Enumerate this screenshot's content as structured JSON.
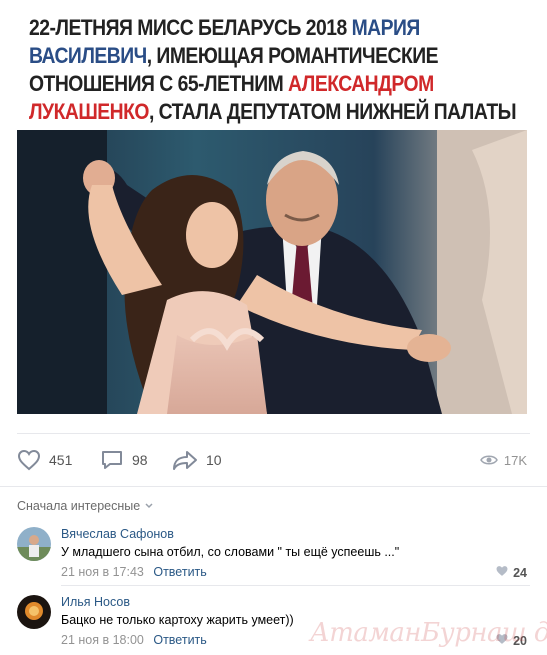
{
  "headline": {
    "part1": "22-ЛЕТНЯЯ МИСС БЕЛАРУСЬ 2018 ",
    "name1": "МАРИЯ ВАСИЛЕВИЧ",
    "part2": ", ИМЕЮЩАЯ РОМАНТИЧЕСКИЕ ОТНОШЕНИЯ С 65-ЛЕТНИМ ",
    "name2": "АЛЕКСАНДРОМ ЛУКАШЕНКО",
    "part3": ", СТАЛА ДЕПУТАТОМ НИЖНЕЙ ПАЛАТЫ ПАРЛАМЕНТА БЕЛАРУСИ."
  },
  "colors": {
    "name1": "#2a4d86",
    "name2": "#d0282a",
    "link": "#2a5885"
  },
  "actions": {
    "likes": "451",
    "comments": "98",
    "shares": "10",
    "views": "17K"
  },
  "sort_label": "Сначала интересные",
  "comments": [
    {
      "author": "Вячеслав Сафонов",
      "text": "У младшего сына отбил, со словами \" ты ещё успеешь ...\"",
      "date": "21 ноя в 17:43",
      "reply": "Ответить",
      "likes": "24"
    },
    {
      "author": "Илья Носов",
      "text": "Бацко не только картоху жарить умеет))",
      "date": "21 ноя в 18:00",
      "reply": "Ответить",
      "likes": "20"
    }
  ],
  "watermark": "АтаманБурнаш для ЯП",
  "icons": [
    "heart-icon",
    "comment-icon",
    "share-icon",
    "eye-icon",
    "chevron-down-icon"
  ]
}
